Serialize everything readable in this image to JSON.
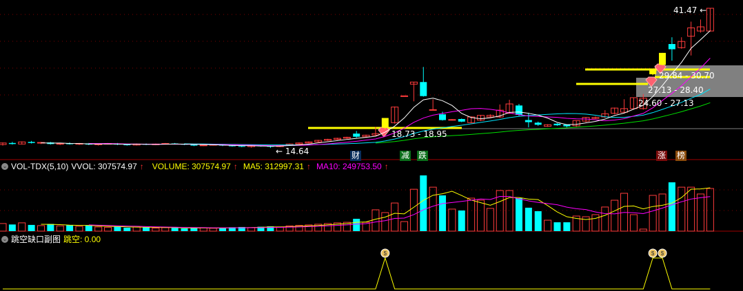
{
  "colors": {
    "up": "#ff3c3c",
    "down": "#00ffff",
    "special": "#ffff00",
    "ma5": "#ffffff",
    "ma10": "#ff00ff",
    "ma20": "#00e5ff",
    "ma40": "#00e000",
    "vol_ma5": "#ffff00",
    "vol_ma10": "#ff00ff",
    "gap_line": "#ffff00",
    "grid": "#800000"
  },
  "price_panel": {
    "high_label": "41.47",
    "low_label": "14.64",
    "gap_labels": [
      "18.73 - 18.95",
      "29.84 - 30.70",
      "27.13 - 28.40",
      "24.60 - 27.13"
    ],
    "icons": [
      "gem-icon",
      "gem-icon",
      "gem-icon"
    ],
    "event_tags": [
      {
        "label": "财",
        "bg": "#0a2e5c"
      },
      {
        "label": "减",
        "bg": "#0a6e1a"
      },
      {
        "label": "跌",
        "bg": "#0a6e1a"
      },
      {
        "label": "涨",
        "bg": "#7a0a0a"
      },
      {
        "label": "榜",
        "bg": "#8a4a0a"
      }
    ],
    "special_candles": [
      40,
      68,
      69
    ],
    "ohlc": [
      [
        15.3,
        15.7,
        15.1,
        15.6
      ],
      [
        15.6,
        15.8,
        15.3,
        15.4
      ],
      [
        15.4,
        15.9,
        15.3,
        15.8
      ],
      [
        15.8,
        16.0,
        15.5,
        15.6
      ],
      [
        15.6,
        15.8,
        15.4,
        15.7
      ],
      [
        15.7,
        15.8,
        15.3,
        15.4
      ],
      [
        15.4,
        15.6,
        15.2,
        15.5
      ],
      [
        15.5,
        15.7,
        15.3,
        15.4
      ],
      [
        15.4,
        15.6,
        15.2,
        15.5
      ],
      [
        15.5,
        15.6,
        15.2,
        15.3
      ],
      [
        15.3,
        15.5,
        15.1,
        15.4
      ],
      [
        15.4,
        15.6,
        15.3,
        15.5
      ],
      [
        15.5,
        15.6,
        15.2,
        15.3
      ],
      [
        15.3,
        15.4,
        15.1,
        15.2
      ],
      [
        15.2,
        15.5,
        15.1,
        15.4
      ],
      [
        15.4,
        15.5,
        15.2,
        15.3
      ],
      [
        15.3,
        15.5,
        15.2,
        15.4
      ],
      [
        15.4,
        15.6,
        15.3,
        15.5
      ],
      [
        15.5,
        15.6,
        15.3,
        15.4
      ],
      [
        15.4,
        15.5,
        15.2,
        15.3
      ],
      [
        15.3,
        15.4,
        15.0,
        15.1
      ],
      [
        15.1,
        15.3,
        15.0,
        15.2
      ],
      [
        15.2,
        15.4,
        15.1,
        15.3
      ],
      [
        15.3,
        15.4,
        15.0,
        15.1
      ],
      [
        15.1,
        15.2,
        14.9,
        15.0
      ],
      [
        15.0,
        15.1,
        14.8,
        14.9
      ],
      [
        14.9,
        15.2,
        14.7,
        15.1
      ],
      [
        15.1,
        15.3,
        14.9,
        15.0
      ],
      [
        15.0,
        15.2,
        14.64,
        14.9
      ],
      [
        14.9,
        15.3,
        14.8,
        15.2
      ],
      [
        15.2,
        15.5,
        15.1,
        15.4
      ],
      [
        15.4,
        15.7,
        15.3,
        15.6
      ],
      [
        15.6,
        15.9,
        15.5,
        15.8
      ],
      [
        15.8,
        16.2,
        15.7,
        16.1
      ],
      [
        16.1,
        16.4,
        16.0,
        16.3
      ],
      [
        16.3,
        16.6,
        16.2,
        16.5
      ],
      [
        16.5,
        16.8,
        16.4,
        16.7
      ],
      [
        17.4,
        17.9,
        16.6,
        16.8
      ],
      [
        16.8,
        17.2,
        16.7,
        17.1
      ],
      [
        17.1,
        18.7,
        17.0,
        17.4
      ],
      [
        18.5,
        20.4,
        18.3,
        20.4
      ],
      [
        19.5,
        22.6,
        19.3,
        22.5
      ],
      [
        24.6,
        24.7,
        24.5,
        24.65
      ],
      [
        26.9,
        27.3,
        23.6,
        27.3
      ],
      [
        27.3,
        30.2,
        24.5,
        24.6
      ],
      [
        21.9,
        24.0,
        21.9,
        22.0
      ],
      [
        21.1,
        21.6,
        19.9,
        20.0
      ],
      [
        20.0,
        20.2,
        19.9,
        20.1
      ],
      [
        20.2,
        20.3,
        19.6,
        19.7
      ],
      [
        19.5,
        20.7,
        19.4,
        20.6
      ],
      [
        20.0,
        21.0,
        19.8,
        20.9
      ],
      [
        20.6,
        21.1,
        20.5,
        20.9
      ],
      [
        20.6,
        23.0,
        20.4,
        21.9
      ],
      [
        21.3,
        23.9,
        21.2,
        23.1
      ],
      [
        22.8,
        23.1,
        20.8,
        21.0
      ],
      [
        20.0,
        21.4,
        18.6,
        19.6
      ],
      [
        19.5,
        19.7,
        18.9,
        19.1
      ],
      [
        18.8,
        19.2,
        18.7,
        19.1
      ],
      [
        19.3,
        19.4,
        18.9,
        19.0
      ],
      [
        19.1,
        19.2,
        18.6,
        18.8
      ],
      [
        18.9,
        19.9,
        18.7,
        19.9
      ],
      [
        19.8,
        20.6,
        19.6,
        20.5
      ],
      [
        20.3,
        20.7,
        20.2,
        20.5
      ],
      [
        20.6,
        21.9,
        20.4,
        21.2
      ],
      [
        21.3,
        22.4,
        21.1,
        22.3
      ],
      [
        21.5,
        24.0,
        21.4,
        22.2
      ],
      [
        22.2,
        24.3,
        22.0,
        24.3
      ],
      [
        22.2,
        25.0,
        22.0,
        24.2
      ],
      [
        28.8,
        29.6,
        28.6,
        29.6
      ],
      [
        30.6,
        32.9,
        30.5,
        32.9
      ],
      [
        34.6,
        35.9,
        31.4,
        33.6
      ],
      [
        33.9,
        35.9,
        33.7,
        35.1
      ],
      [
        36.1,
        38.9,
        32.4,
        37.7
      ],
      [
        37.1,
        39.3,
        36.8,
        37.9
      ],
      [
        37.1,
        41.47,
        37.0,
        41.47
      ]
    ]
  },
  "volume_panel": {
    "indicator": "VOL-TDX(5,10)",
    "vvol": "VVOL: 307574.97",
    "volume": "VOLUME: 307574.97",
    "ma5": "MA5: 312997.31",
    "ma10": "MA10: 249753.50",
    "values": [
      55000,
      48000,
      60000,
      45000,
      40000,
      52000,
      38000,
      42000,
      35000,
      40000,
      30000,
      28000,
      33000,
      25000,
      30000,
      27000,
      22000,
      26000,
      24000,
      20000,
      23000,
      25000,
      21000,
      24000,
      28000,
      30000,
      26000,
      32000,
      35000,
      30000,
      38000,
      42000,
      45000,
      50000,
      55000,
      60000,
      64000,
      89000,
      64000,
      154000,
      134000,
      203000,
      69000,
      302000,
      402000,
      317000,
      258000,
      159000,
      149000,
      238000,
      223000,
      164000,
      293000,
      293000,
      238000,
      169000,
      144000,
      79000,
      64000,
      64000,
      109000,
      104000,
      119000,
      174000,
      223000,
      273000,
      119000,
      15000,
      258000,
      268000,
      352000,
      317000,
      317000,
      268000,
      307575
    ]
  },
  "gap_panel": {
    "title": "跳空缺口副图",
    "value": "跳空: 0.00",
    "icons": [
      "money-bag-icon",
      "money-bag-icon",
      "money-bag-icon"
    ],
    "signal_candles": [
      40,
      68,
      69
    ]
  }
}
